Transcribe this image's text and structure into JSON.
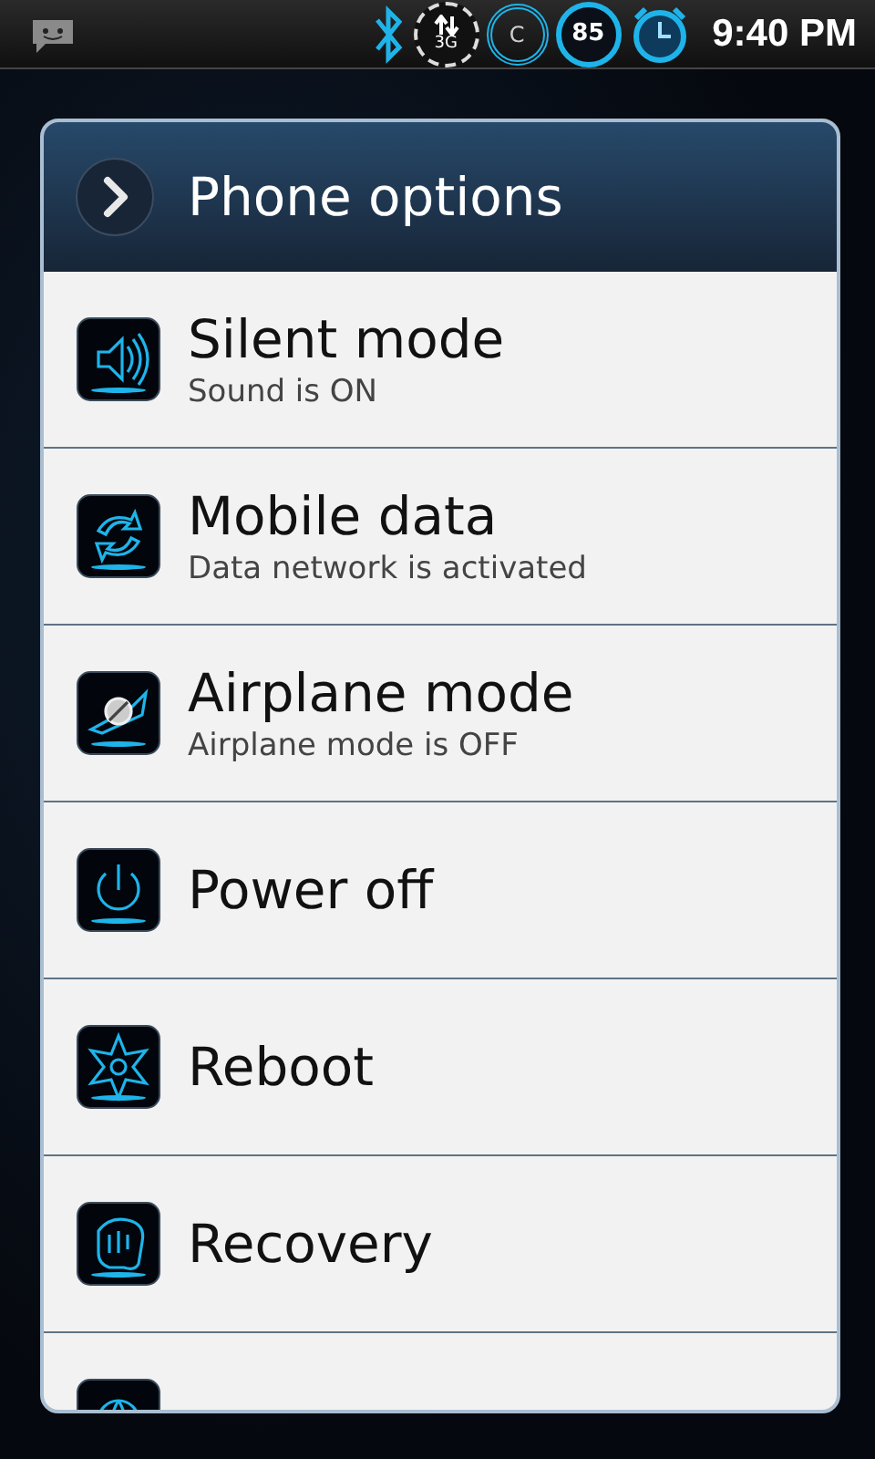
{
  "status_bar": {
    "network": "3G",
    "ring_label": "C",
    "battery": "85",
    "time": "9:40 PM"
  },
  "dialog": {
    "title": "Phone options",
    "items": [
      {
        "kind": "speaker",
        "title": "Silent mode",
        "subtitle": "Sound is ON"
      },
      {
        "kind": "sync",
        "title": "Mobile data",
        "subtitle": "Data network is activated"
      },
      {
        "kind": "airplane",
        "title": "Airplane mode",
        "subtitle": "Airplane mode is OFF"
      },
      {
        "kind": "power",
        "title": "Power off"
      },
      {
        "kind": "star",
        "title": "Reboot"
      },
      {
        "kind": "hand",
        "title": "Recovery"
      },
      {
        "kind": "globe"
      }
    ]
  }
}
